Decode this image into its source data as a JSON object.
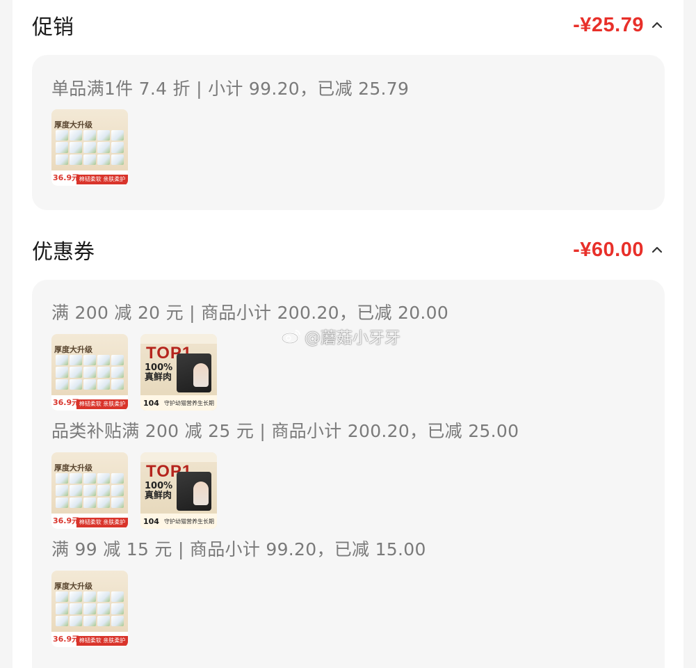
{
  "promotion": {
    "title": "促销",
    "amount": "-¥25.79",
    "rule": "单品满1件 7.4 折 | 小计 99.20，已减 25.79",
    "items": [
      {
        "product": "tissue",
        "thumb_price": "36.9元",
        "thumb_tag": "棉韧柔软 亲肤柔护",
        "thumb_head": "厚度大升级"
      }
    ]
  },
  "coupon": {
    "title": "优惠券",
    "amount": "-¥60.00",
    "groups": [
      {
        "rule": "满 200 减 20 元 | 商品小计 200.20，已减 20.00",
        "items": [
          {
            "product": "tissue",
            "thumb_price": "36.9元",
            "thumb_tag": "棉韧柔软 亲肤柔护",
            "thumb_head": "厚度大升级"
          },
          {
            "product": "meat",
            "thumb_badge": "TOP1",
            "thumb_pct": "100%\n真鲜肉",
            "thumb_price": "104",
            "thumb_slogan": "守护幼猫营养生长期"
          }
        ]
      },
      {
        "rule": "品类补贴满 200 减 25 元 | 商品小计 200.20，已减 25.00",
        "items": [
          {
            "product": "tissue",
            "thumb_price": "36.9元",
            "thumb_tag": "棉韧柔软 亲肤柔护",
            "thumb_head": "厚度大升级"
          },
          {
            "product": "meat",
            "thumb_badge": "TOP1",
            "thumb_pct": "100%\n真鲜肉",
            "thumb_price": "104",
            "thumb_slogan": "守护幼猫营养生长期"
          }
        ]
      },
      {
        "rule": "满 99 减 15 元 | 商品小计 99.20，已减 15.00",
        "items": [
          {
            "product": "tissue",
            "thumb_price": "36.9元",
            "thumb_tag": "棉韧柔软 亲肤柔护",
            "thumb_head": "厚度大升级"
          }
        ]
      }
    ]
  },
  "watermark": {
    "text": "@蘑菇小牙牙",
    "icon": "weibo-icon"
  },
  "colors": {
    "accent": "#e8302a",
    "card_bg": "#f6f6f6",
    "muted_text": "#7a7a7a"
  }
}
